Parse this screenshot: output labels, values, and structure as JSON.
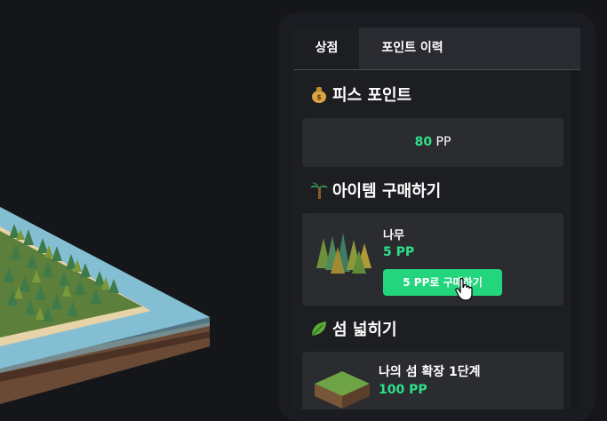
{
  "tabs": {
    "shop": "상점",
    "history": "포인트 이력"
  },
  "points_section": {
    "title": "피스 포인트",
    "icon": "money-bag-icon",
    "value": "80",
    "unit": " PP"
  },
  "shop_section": {
    "title": "아이템 구매하기",
    "icon": "palm-tree-icon"
  },
  "tree_item": {
    "name": "나무",
    "price": "5 PP",
    "buy_label": "5 PP로 구매하기"
  },
  "expand_section": {
    "title": "섬 넓히기",
    "icon": "leaf-icon"
  },
  "expand_item": {
    "name": "나의 섬 확장 1단계",
    "price": "100 PP"
  },
  "colors": {
    "accent": "#23d57c",
    "price": "#2ee08a",
    "background": "#15161a",
    "panel": "#1b1c21"
  }
}
